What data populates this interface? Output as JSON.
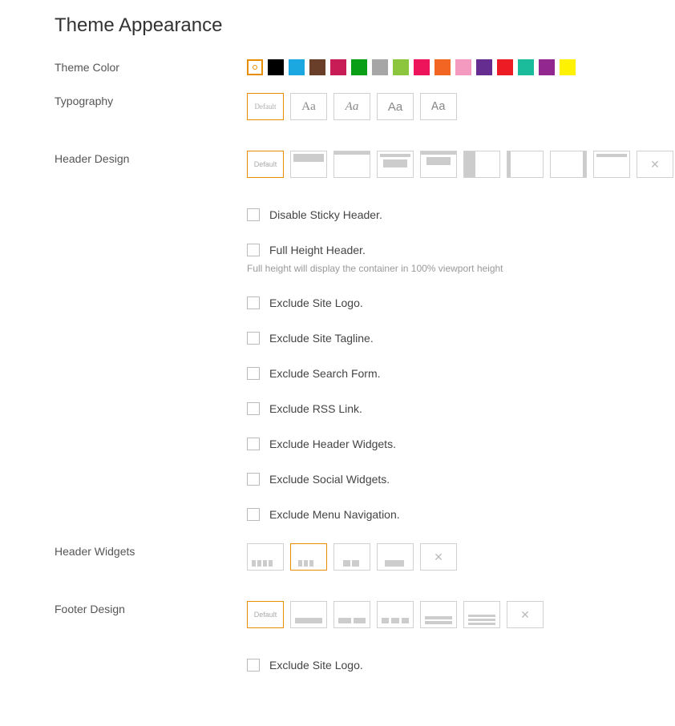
{
  "title": "Theme Appearance",
  "labels": {
    "theme_color": "Theme Color",
    "typography": "Typography",
    "header_design": "Header Design",
    "header_widgets": "Header Widgets",
    "footer_design": "Footer Design"
  },
  "theme_colors": [
    "#ffffff",
    "#000000",
    "#1ba8e0",
    "#6a3f2a",
    "#c71c56",
    "#0a9e17",
    "#a6a6a6",
    "#8cc63f",
    "#ed145b",
    "#f26522",
    "#f49ac1",
    "#662d91",
    "#ed1c24",
    "#1abc9c",
    "#92278f",
    "#fff200"
  ],
  "theme_color_selected": 0,
  "typography": {
    "default_label": "Default",
    "samples": [
      "Aa",
      "Aa",
      "Aa",
      "Aa"
    ],
    "selected": 0
  },
  "header_design": {
    "default_label": "Default",
    "selected": 0
  },
  "header_checkboxes": [
    {
      "label": "Disable Sticky Header.",
      "help": null
    },
    {
      "label": "Full Height Header.",
      "help": "Full height will display the container in 100% viewport height"
    },
    {
      "label": "Exclude Site Logo.",
      "help": null
    },
    {
      "label": "Exclude Site Tagline.",
      "help": null
    },
    {
      "label": "Exclude Search Form.",
      "help": null
    },
    {
      "label": "Exclude RSS Link.",
      "help": null
    },
    {
      "label": "Exclude Header Widgets.",
      "help": null
    },
    {
      "label": "Exclude Social Widgets.",
      "help": null
    },
    {
      "label": "Exclude Menu Navigation.",
      "help": null
    }
  ],
  "header_widgets": {
    "selected": 1
  },
  "footer_design": {
    "default_label": "Default",
    "selected": 0
  },
  "footer_checkboxes": [
    {
      "label": "Exclude Site Logo.",
      "help": null
    }
  ]
}
